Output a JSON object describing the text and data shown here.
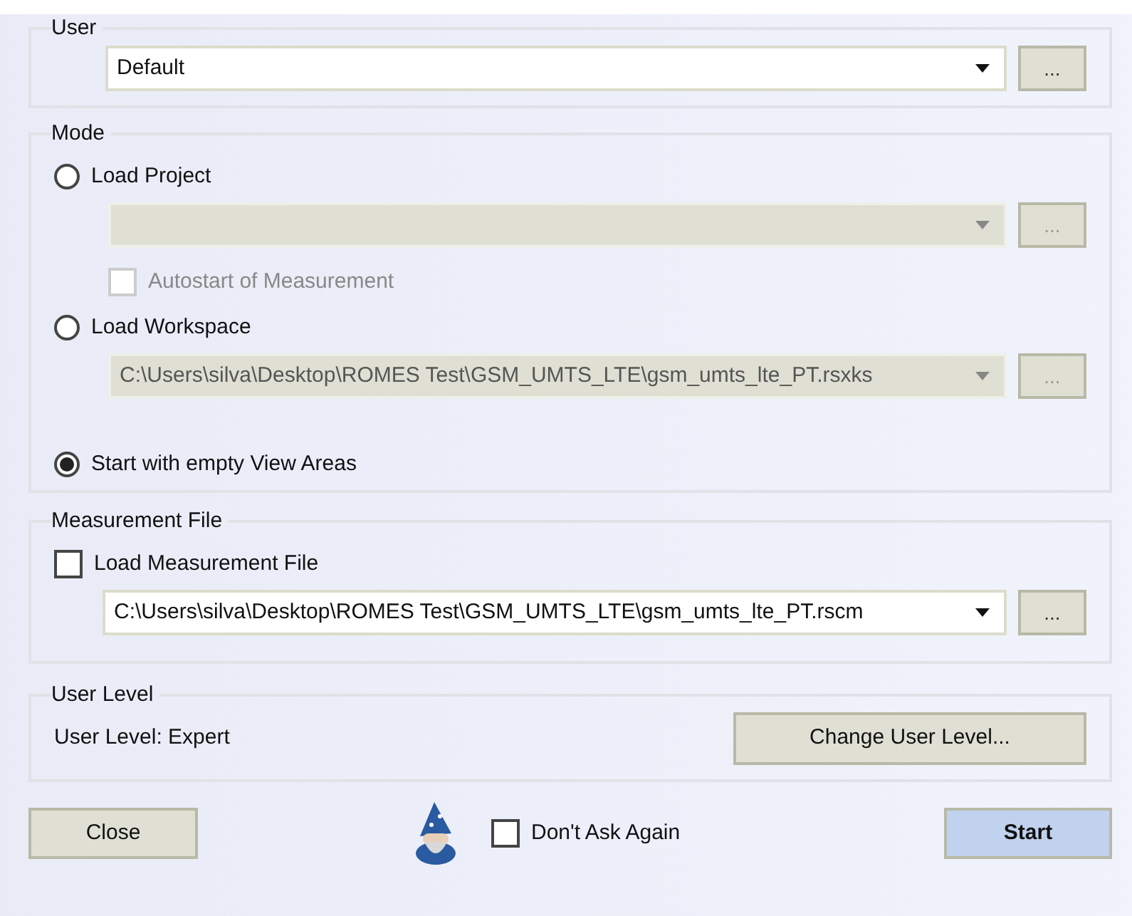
{
  "user": {
    "title": "User",
    "combo": {
      "value": "Default",
      "disabled": false
    },
    "button": {
      "label": "...",
      "disabled": false
    }
  },
  "mode": {
    "title": "Mode",
    "items": [
      {
        "kind": "radio",
        "label": "Load Project",
        "selected": false
      },
      {
        "kind": "combo",
        "disabled": true,
        "button": {
          "label": "...",
          "disabled": true
        }
      },
      {
        "kind": "checkbox",
        "label": "Autostart of Measurement",
        "checked": false,
        "disabled": true
      },
      {
        "kind": "radio",
        "label": "Load Workspace",
        "selected": false
      },
      {
        "kind": "combo",
        "value": "C:\\Users\\silva\\Desktop\\ROMES Test\\GSM_UMTS_LTE\\gsm_umts_lte_PT.rsxks",
        "disabled": true,
        "button": {
          "label": "...",
          "disabled": true
        }
      },
      {
        "kind": "radio",
        "label": "Start with empty View Areas",
        "selected": true
      }
    ]
  },
  "measurement_file": {
    "title": "Measurement File",
    "items": [
      {
        "kind": "checkbox",
        "label": "Load Measurement File",
        "checked": false,
        "disabled": false
      },
      {
        "kind": "combo",
        "value": "C:\\Users\\silva\\Desktop\\ROMES Test\\GSM_UMTS_LTE\\gsm_umts_lte_PT.rscm",
        "disabled": false,
        "button": {
          "label": "...",
          "disabled": false
        }
      }
    ]
  },
  "user_level": {
    "title": "User Level",
    "text": "User Level: Expert",
    "button": "Change User Level..."
  },
  "footer": {
    "close": "Close",
    "dont_ask": {
      "label": "Don't Ask Again",
      "checked": false
    },
    "start": "Start"
  }
}
